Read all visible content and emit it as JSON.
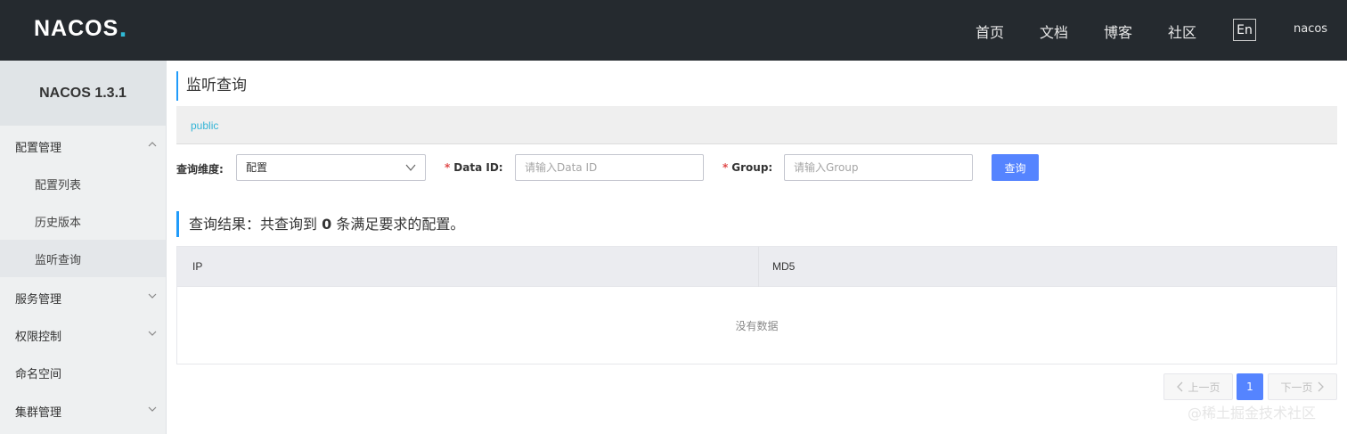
{
  "header": {
    "logo_text": "NACOS",
    "logo_dot": ".",
    "nav": [
      "首页",
      "文档",
      "博客",
      "社区"
    ],
    "lang": "En",
    "user": "nacos"
  },
  "sidebar": {
    "brand": "NACOS 1.3.1",
    "items": [
      {
        "label": "配置管理",
        "level": 1,
        "chevron": "up"
      },
      {
        "label": "配置列表",
        "level": 2
      },
      {
        "label": "历史版本",
        "level": 2
      },
      {
        "label": "监听查询",
        "level": 2,
        "active": true
      },
      {
        "label": "服务管理",
        "level": 1,
        "chevron": "down"
      },
      {
        "label": "权限控制",
        "level": 1,
        "chevron": "down"
      },
      {
        "label": "命名空间",
        "level": 1
      },
      {
        "label": "集群管理",
        "level": 1,
        "chevron": "down"
      }
    ]
  },
  "main": {
    "title": "监听查询",
    "namespace": "public",
    "filters": {
      "dimension_label": "查询维度:",
      "dimension_value": "配置",
      "dataid_label": "Data ID:",
      "dataid_placeholder": "请输入Data ID",
      "group_label": "Group:",
      "group_placeholder": "请输入Group",
      "required_mark": "*",
      "query_button": "查询"
    },
    "result": {
      "prefix": "查询结果：共查询到 ",
      "count": "0",
      "suffix": " 条满足要求的配置。"
    },
    "table": {
      "columns": [
        "IP",
        "MD5"
      ],
      "empty_text": "没有数据"
    },
    "pagination": {
      "prev": "上一页",
      "current": "1",
      "next": "下一页"
    }
  },
  "watermark": "@稀土掘金技术社区",
  "colors": {
    "header_bg": "#252a2f",
    "accent": "#209bfa",
    "primary_button": "#5584ff",
    "namespace_link": "#33b4d6"
  }
}
